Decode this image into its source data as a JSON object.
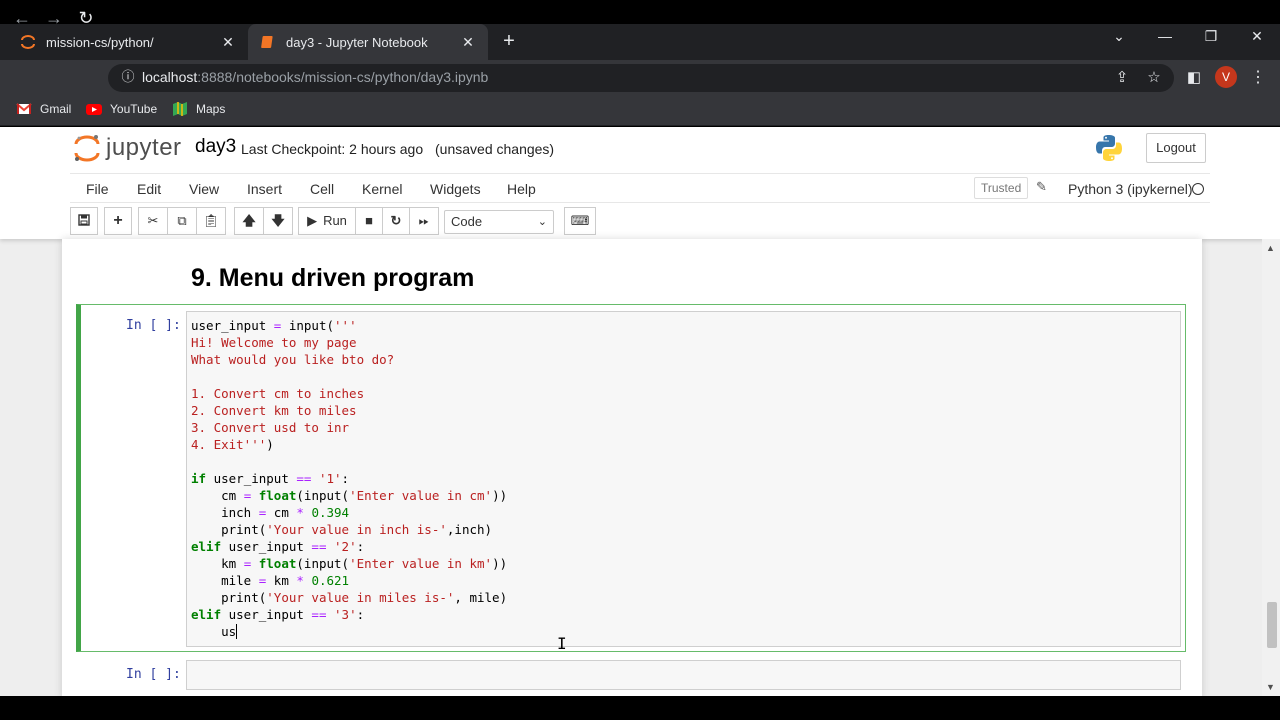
{
  "browser": {
    "tabs": [
      {
        "title": "mission-cs/python/",
        "active": false
      },
      {
        "title": "day3 - Jupyter Notebook",
        "active": true
      }
    ],
    "url_host": "localhost",
    "url_rest": ":8888/notebooks/mission-cs/python/day3.ipynb",
    "avatar_letter": "V",
    "bookmarks": [
      "Gmail",
      "YouTube",
      "Maps"
    ]
  },
  "jupyter": {
    "logo_text": "jupyter",
    "notebook_name": "day3",
    "checkpoint": "Last Checkpoint: 2 hours ago",
    "unsaved": "(unsaved changes)",
    "logout": "Logout",
    "menu": [
      "File",
      "Edit",
      "View",
      "Insert",
      "Cell",
      "Kernel",
      "Widgets",
      "Help"
    ],
    "trusted": "Trusted",
    "kernel": "Python 3 (ipykernel)",
    "toolbar": {
      "run_label": "Run",
      "cell_type": "Code"
    }
  },
  "notebook": {
    "heading": "9. Menu driven program",
    "prompt_1": "In [ ]:",
    "prompt_2": "In [ ]:"
  },
  "colors": {
    "selected_cell_border": "#42a548",
    "prompt": "#303f9f",
    "keyword": "#008000",
    "string": "#ba2121",
    "operator": "#aa22ff"
  }
}
